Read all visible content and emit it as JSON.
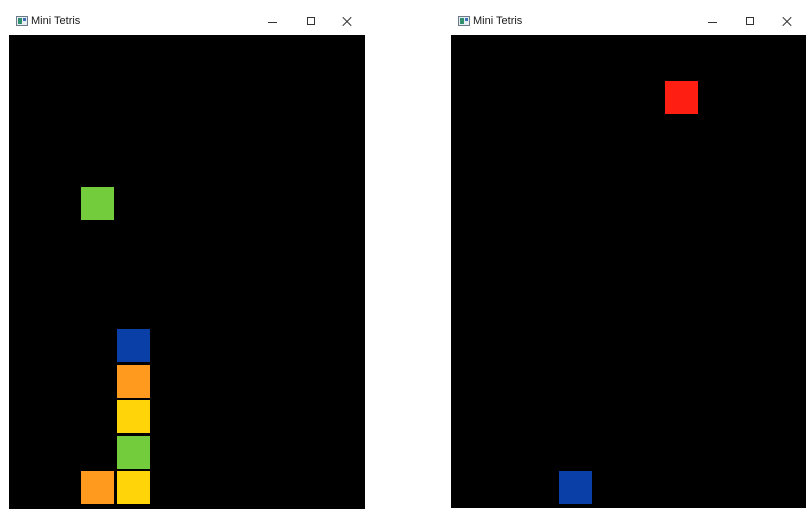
{
  "windows": [
    {
      "title": "Mini Tetris",
      "icon": "app-icon",
      "controls": [
        "minimize-icon",
        "maximize-icon",
        "close-icon"
      ],
      "board_background": "#000000",
      "blocks": [
        {
          "role": "falling",
          "color": "#72cc3c",
          "col": 2,
          "row": 4
        },
        {
          "role": "stacked",
          "color": "#0a3fa8",
          "col": 3,
          "row": 8
        },
        {
          "role": "stacked",
          "color": "#ff9a1f",
          "col": 3,
          "row": 9
        },
        {
          "role": "stacked",
          "color": "#ffd50a",
          "col": 3,
          "row": 10
        },
        {
          "role": "stacked",
          "color": "#72cc3c",
          "col": 3,
          "row": 11
        },
        {
          "role": "stacked",
          "color": "#ff9a1f",
          "col": 2,
          "row": 12
        },
        {
          "role": "stacked",
          "color": "#ffd50a",
          "col": 3,
          "row": 12
        }
      ]
    },
    {
      "title": "Mini Tetris",
      "icon": "app-icon",
      "controls": [
        "minimize-icon",
        "maximize-icon",
        "close-icon"
      ],
      "board_background": "#000000",
      "blocks": [
        {
          "role": "falling",
          "color": "#ff1f12",
          "col": 6,
          "row": 1
        },
        {
          "role": "stacked",
          "color": "#0a3fa8",
          "col": 3,
          "row": 12
        }
      ]
    }
  ]
}
